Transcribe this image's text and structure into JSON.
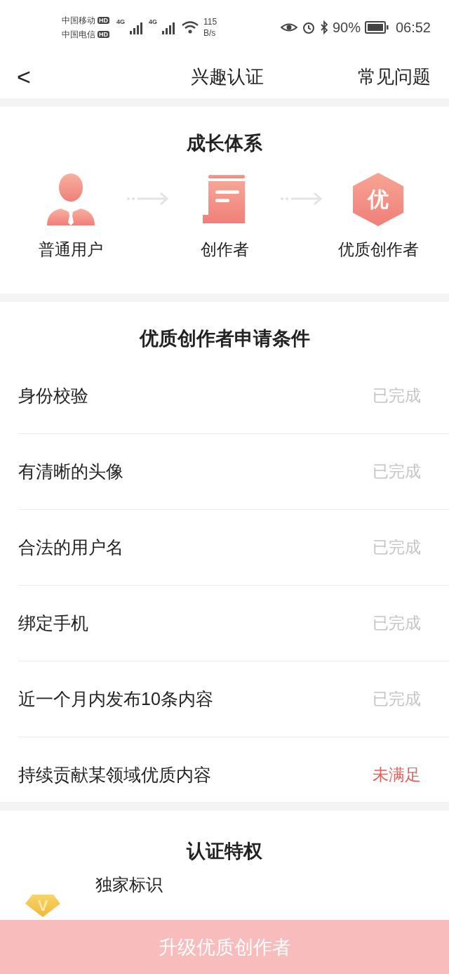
{
  "status_bar": {
    "carriers": [
      {
        "name": "中国移动",
        "badge": "HD"
      },
      {
        "name": "中国电信",
        "badge": "HD"
      }
    ],
    "signals": [
      "4G",
      "4G"
    ],
    "speed": [
      "115",
      "B/s"
    ],
    "battery_text": "90%",
    "time": "06:52"
  },
  "header": {
    "back": "<",
    "title": "兴趣认证",
    "action": "常见问题"
  },
  "growth": {
    "title": "成长体系",
    "steps": [
      {
        "kind": "user",
        "label": "普通用户"
      },
      {
        "kind": "doc",
        "label": "创作者"
      },
      {
        "kind": "badge",
        "badge_text": "优",
        "label": "优质创作者"
      }
    ]
  },
  "conditions": {
    "title": "优质创作者申请条件",
    "items": [
      {
        "label": "身份校验",
        "status": "已完成",
        "met": true
      },
      {
        "label": "有清晰的头像",
        "status": "已完成",
        "met": true
      },
      {
        "label": "合法的用户名",
        "status": "已完成",
        "met": true
      },
      {
        "label": "绑定手机",
        "status": "已完成",
        "met": true
      },
      {
        "label": "近一个月内发布10条内容",
        "status": "已完成",
        "met": true
      },
      {
        "label": "持续贡献某领域优质内容",
        "status": "未满足",
        "met": false
      }
    ]
  },
  "privileges": {
    "title": "认证特权",
    "items": [
      {
        "icon_text": "V",
        "title": "独家标识"
      }
    ]
  },
  "upgrade_button": {
    "label": "升级优质创作者",
    "disabled": true
  }
}
